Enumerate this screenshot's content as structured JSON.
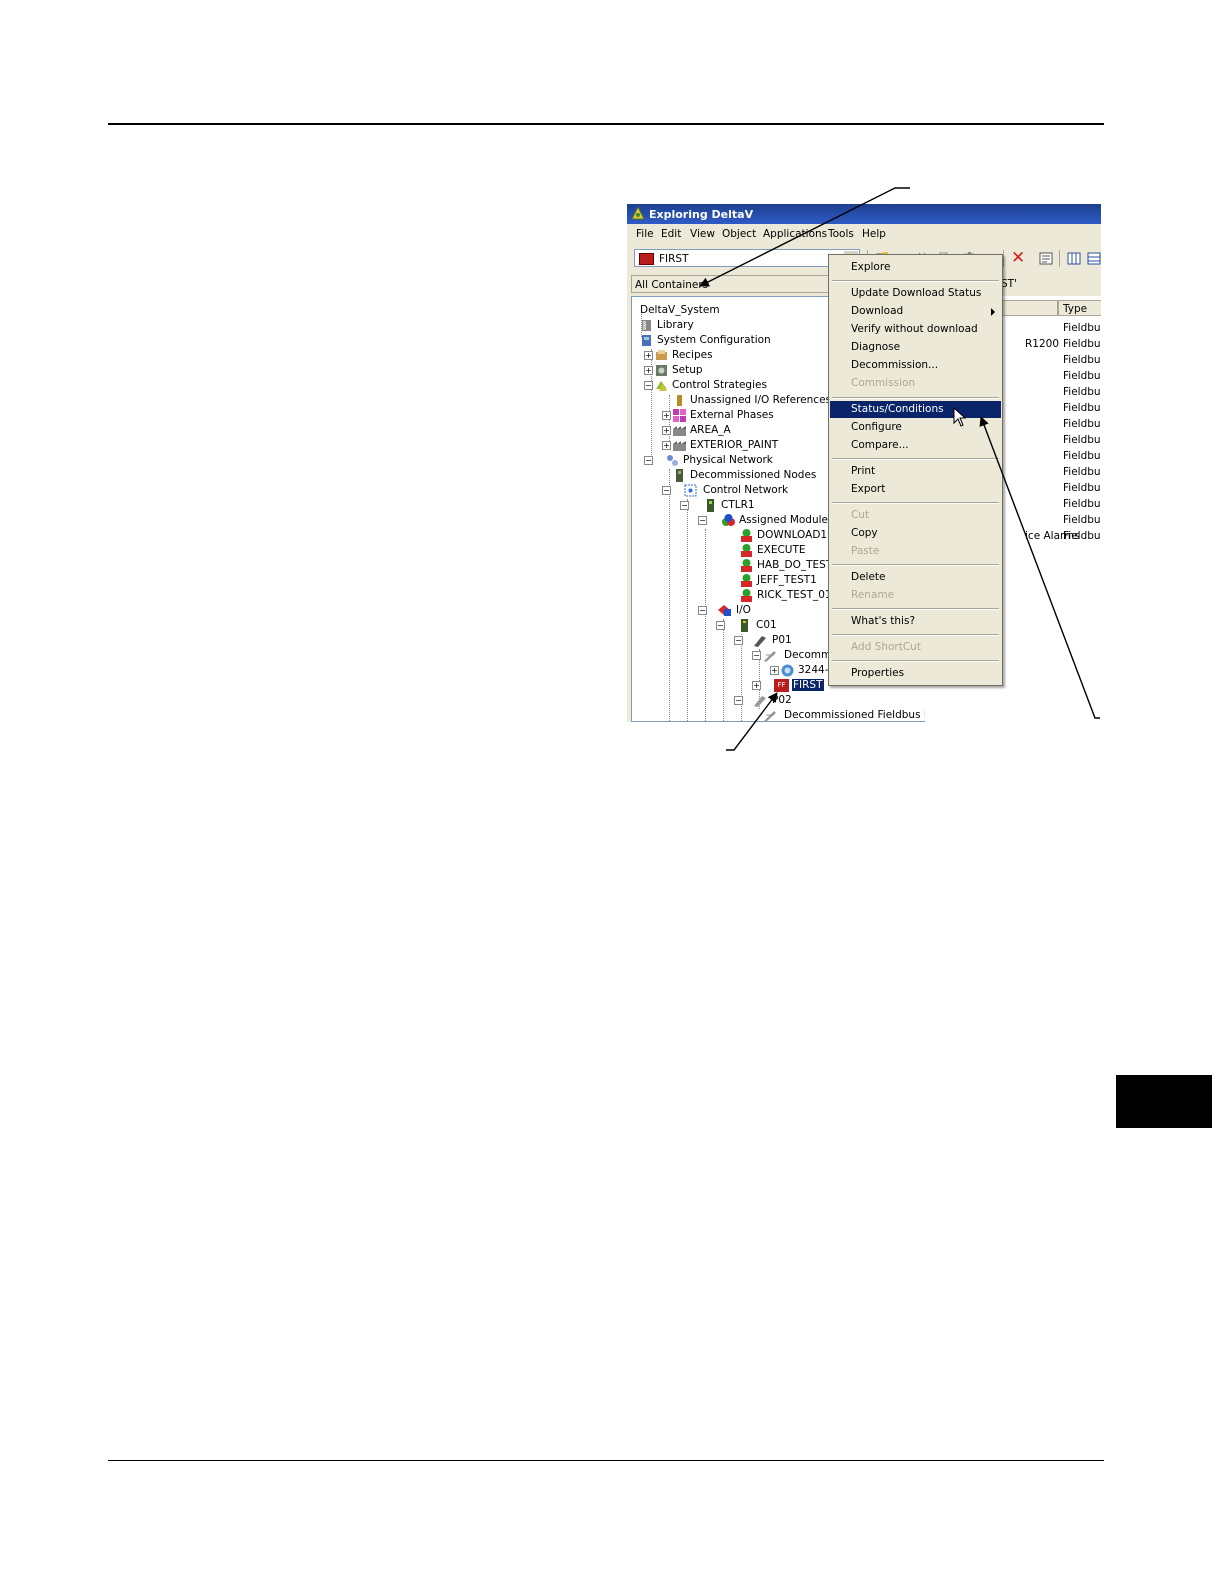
{
  "window": {
    "title": "Exploring DeltaV"
  },
  "menubar": [
    "File",
    "Edit",
    "View",
    "Object",
    "Applications",
    "Tools",
    "Help"
  ],
  "toolbar": {
    "combo_value": "FIRST"
  },
  "left_header": "All Containers",
  "right_header_fragment": "ST'",
  "tree": [
    {
      "label": "DeltaV_System"
    },
    {
      "label": "Library"
    },
    {
      "label": "System Configuration"
    },
    {
      "label": "Recipes"
    },
    {
      "label": "Setup"
    },
    {
      "label": "Control Strategies"
    },
    {
      "label": "Unassigned I/O References"
    },
    {
      "label": "External Phases"
    },
    {
      "label": "AREA_A"
    },
    {
      "label": "EXTERIOR_PAINT"
    },
    {
      "label": "Physical Network"
    },
    {
      "label": "Decommissioned Nodes"
    },
    {
      "label": "Control Network"
    },
    {
      "label": "CTLR1"
    },
    {
      "label": "Assigned Modules"
    },
    {
      "label": "DOWNLOAD1"
    },
    {
      "label": "EXECUTE"
    },
    {
      "label": "HAB_DO_TEST"
    },
    {
      "label": "JEFF_TEST1"
    },
    {
      "label": "RICK_TEST_01"
    },
    {
      "label": "I/O"
    },
    {
      "label": "C01"
    },
    {
      "label": "P01"
    },
    {
      "label": "Decommis"
    },
    {
      "label": "3244-"
    },
    {
      "label": "FIRST",
      "ff": "FF"
    },
    {
      "label": "P02"
    },
    {
      "label": "Decommissioned Fieldbus Devi"
    }
  ],
  "list": {
    "type_header": "Type",
    "type_values": [
      "Fieldbus",
      "Fieldbus",
      "Fieldbus",
      "Fieldbus",
      "Fieldbus",
      "Fieldbus",
      "Fieldbus",
      "Fieldbus",
      "Fieldbus",
      "Fieldbus",
      "Fieldbus",
      "Fieldbus",
      "Fieldbus",
      "Fieldbus"
    ],
    "fragments": [
      "R1200",
      "ice Alarms"
    ]
  },
  "context_menu": {
    "items": [
      {
        "label": "Explore",
        "enabled": true
      },
      {
        "label": "Update Download Status",
        "enabled": true
      },
      {
        "label": "Download",
        "enabled": true
      },
      {
        "label": "Verify without download",
        "enabled": true
      },
      {
        "label": "Diagnose",
        "enabled": true
      },
      {
        "label": "Decommission...",
        "enabled": true
      },
      {
        "label": "Commission",
        "enabled": false
      },
      {
        "label": "Status/Conditions",
        "enabled": true,
        "highlighted": true
      },
      {
        "label": "Configure",
        "enabled": true
      },
      {
        "label": "Compare...",
        "enabled": true
      },
      {
        "label": "Print",
        "enabled": true
      },
      {
        "label": "Export",
        "enabled": true
      },
      {
        "label": "Cut",
        "enabled": false
      },
      {
        "label": "Copy",
        "enabled": true
      },
      {
        "label": "Paste",
        "enabled": false
      },
      {
        "label": "Delete",
        "enabled": true
      },
      {
        "label": "Rename",
        "enabled": false
      },
      {
        "label": "What's this?",
        "enabled": true
      },
      {
        "label": "Add ShortCut",
        "enabled": false
      },
      {
        "label": "Properties",
        "enabled": true
      }
    ]
  },
  "colors": {
    "selection": "#0a246a",
    "titlebar": "#2f5bc6",
    "disabled_text": "#aca899",
    "ff_icon": "#b81c1c"
  }
}
